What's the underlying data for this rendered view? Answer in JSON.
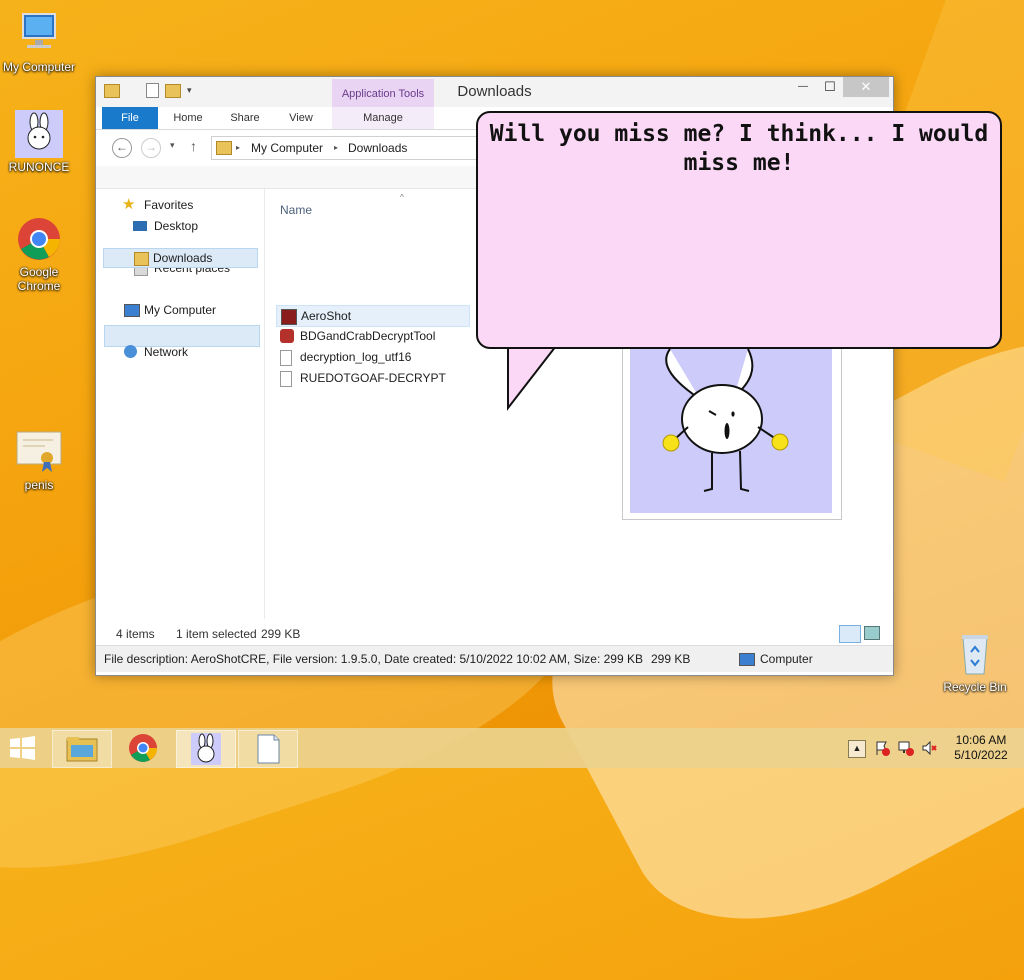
{
  "desktop": {
    "icons": [
      {
        "label": "My Computer",
        "icon": "computer-icon"
      },
      {
        "label": "RUNONCE",
        "icon": "bunny-icon"
      },
      {
        "label": "Google Chrome",
        "icon": "chrome-icon"
      },
      {
        "label": "penis",
        "icon": "certificate-icon"
      },
      {
        "label": "Recycle Bin",
        "icon": "recycle-bin-icon"
      }
    ]
  },
  "window": {
    "title": "Downloads",
    "contextual_tab_group": "Application Tools",
    "controls": {
      "minimize": "—",
      "maximize": "☐",
      "close": "✕"
    },
    "ribbon_tabs": [
      "File",
      "Home",
      "Share",
      "View",
      "Manage"
    ],
    "address": {
      "segments": [
        "My Computer",
        "Downloads"
      ]
    },
    "nav": {
      "favorites_label": "Favorites",
      "favorites": [
        "Desktop",
        "Downloads",
        "Recent places"
      ],
      "selected": "Downloads",
      "computer_label": "My Computer",
      "network_label": "Network"
    },
    "files": {
      "column_header": "Name",
      "items": [
        {
          "name": "AeroShot",
          "icon": "app-icon",
          "selected": true
        },
        {
          "name": "BDGandCrabDecryptTool",
          "icon": "app-icon",
          "selected": false
        },
        {
          "name": "decryption_log_utf16",
          "icon": "text-file-icon",
          "selected": false
        },
        {
          "name": "RUEDOTGOAF-DECRYPT",
          "icon": "text-file-icon",
          "selected": false
        }
      ]
    },
    "status": {
      "count": "4 items",
      "selection": "1 item selected",
      "size": "299 KB"
    },
    "details": {
      "description": "File description: AeroShotCRE, File version: 1.9.5.0, Date created: 5/10/2022 10:02 AM, Size: 299 KB",
      "size": "299 KB",
      "location": "Computer"
    }
  },
  "bubble": {
    "text": "Will you miss me? I think... I would miss me!"
  },
  "taskbar": {
    "buttons": [
      "start-button",
      "file-explorer-icon",
      "chrome-icon",
      "bunny-app-icon",
      "document-icon"
    ],
    "clock": {
      "time": "10:06 AM",
      "date": "5/10/2022"
    }
  },
  "colors": {
    "file_tab": "#1979ca",
    "bubble": "#fad8f6",
    "selection": "#e5f0fa",
    "bunny_bg": "#cccbfa"
  }
}
